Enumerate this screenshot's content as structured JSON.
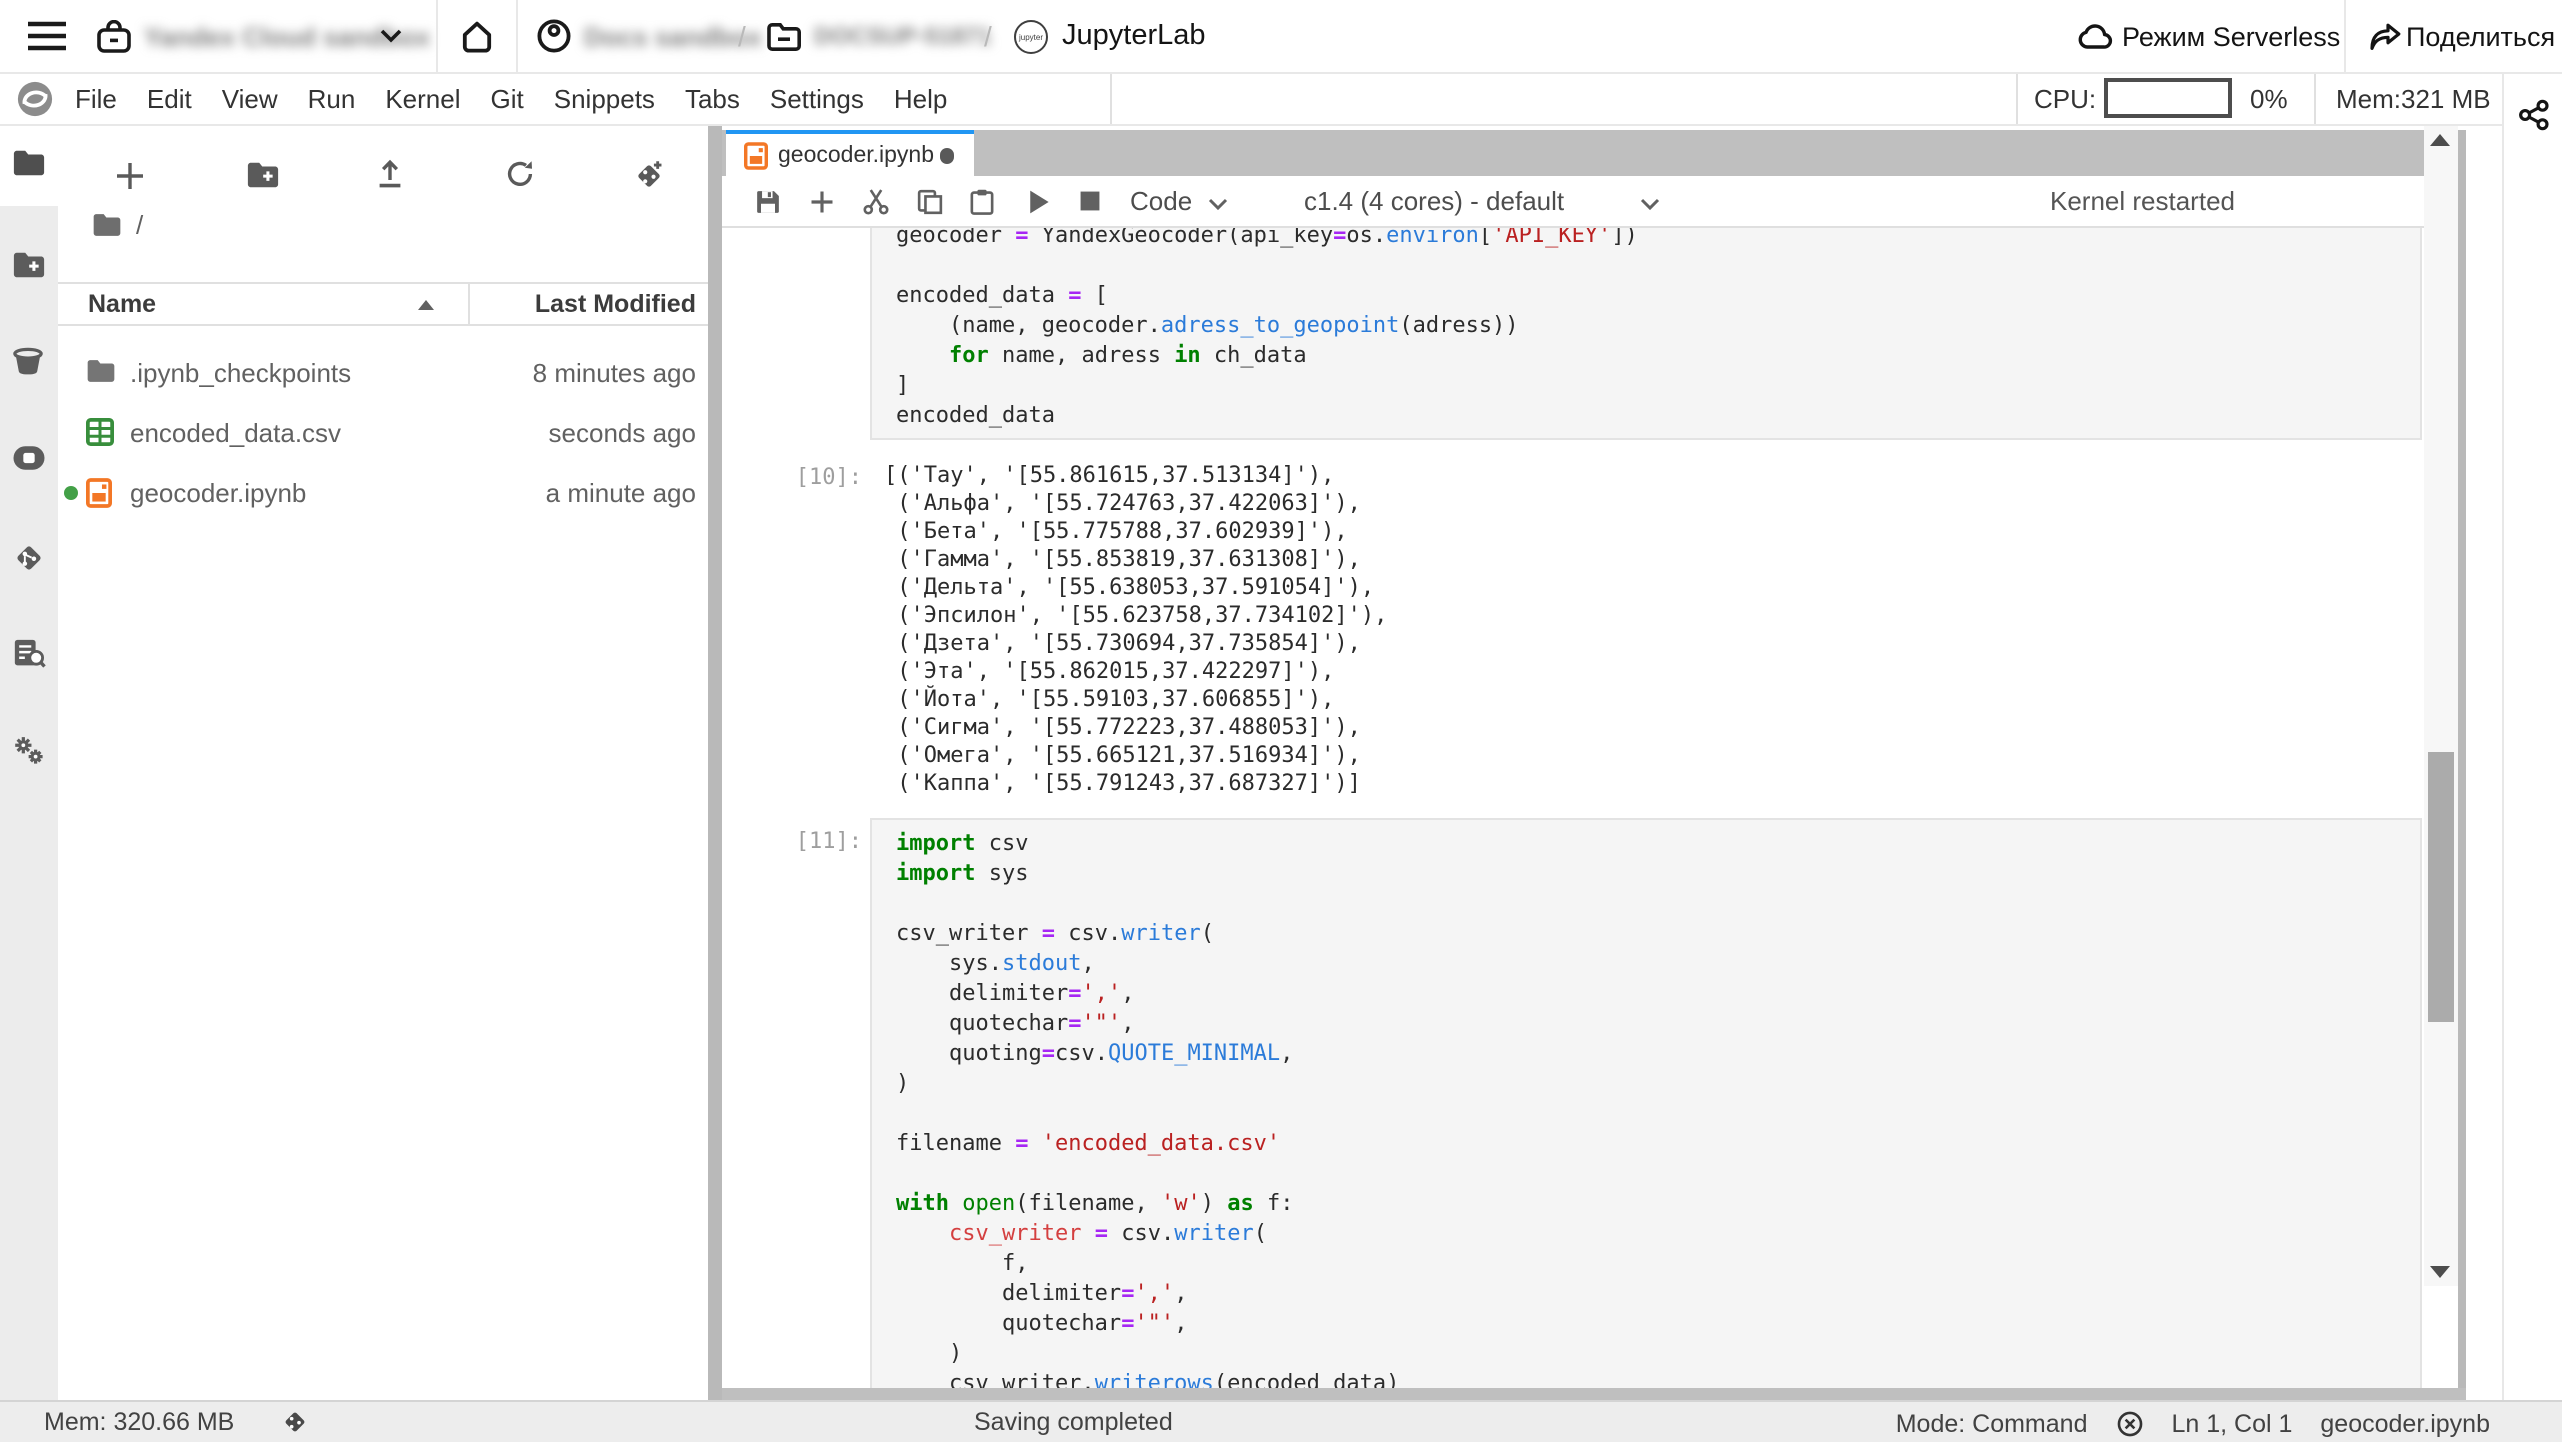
{
  "topbar": {
    "brand": "JupyterLab",
    "path_separator": "/",
    "serverless_label": "Режим Serverless",
    "share_label": "Поделиться",
    "redacted_labels": [
      "Yandex Cloud sandbox",
      "Docs sandbox",
      "DOCSUP-51871"
    ]
  },
  "menubar": {
    "items": [
      "File",
      "Edit",
      "View",
      "Run",
      "Kernel",
      "Git",
      "Snippets",
      "Tabs",
      "Settings",
      "Help"
    ],
    "cpu_label": "CPU:",
    "cpu_percent": "0%",
    "mem_label": "Mem:321 MB"
  },
  "filebrowser": {
    "breadcrumb_root": "/",
    "name_column": "Name",
    "modified_column": "Last Modified",
    "files": [
      {
        "name": ".ipynb_checkpoints",
        "modified": "8 minutes ago",
        "icon": "folder",
        "dirty": false
      },
      {
        "name": "encoded_data.csv",
        "modified": "seconds ago",
        "icon": "csv",
        "dirty": false
      },
      {
        "name": "geocoder.ipynb",
        "modified": "a minute ago",
        "icon": "notebook",
        "dirty": true
      }
    ]
  },
  "dock": {
    "tab_title": "geocoder.ipynb",
    "toolbar": {
      "cell_type": "Code",
      "kernel_selector": "c1.4 (4 cores) - default",
      "status_message": "Kernel restarted"
    }
  },
  "notebook": {
    "cells": [
      {
        "kind": "code",
        "prompt": "",
        "lines": [
          [
            [
              "v",
              "geocoder "
            ],
            [
              "o",
              "="
            ],
            [
              "v",
              " YandexGeocoder(api_key"
            ],
            [
              "o",
              "="
            ],
            [
              "v",
              "os."
            ],
            [
              "p",
              "environ"
            ],
            [
              "v",
              "["
            ],
            [
              "s",
              "'API_KEY'"
            ],
            [
              "v",
              "])"
            ]
          ],
          [],
          [
            [
              "v",
              "encoded_data "
            ],
            [
              "o",
              "="
            ],
            [
              "v",
              " ["
            ]
          ],
          [
            [
              "v",
              "    (name, geocoder."
            ],
            [
              "p",
              "adress_to_geopoint"
            ],
            [
              "v",
              "(adress))"
            ]
          ],
          [
            [
              "v",
              "    "
            ],
            [
              "k",
              "for"
            ],
            [
              "v",
              " name, adress "
            ],
            [
              "k",
              "in"
            ],
            [
              "v",
              " ch_data"
            ]
          ],
          [
            [
              "v",
              "]"
            ]
          ],
          [
            [
              "v",
              "encoded_data"
            ]
          ]
        ]
      },
      {
        "kind": "output",
        "prompt": "[10]:",
        "lines": [
          "[('Тау', '[55.861615,37.513134]'),",
          " ('Альфа', '[55.724763,37.422063]'),",
          " ('Бета', '[55.775788,37.602939]'),",
          " ('Гамма', '[55.853819,37.631308]'),",
          " ('Дельта', '[55.638053,37.591054]'),",
          " ('Эпсилон', '[55.623758,37.734102]'),",
          " ('Дзета', '[55.730694,37.735854]'),",
          " ('Эта', '[55.862015,37.422297]'),",
          " ('Йота', '[55.59103,37.606855]'),",
          " ('Сигма', '[55.772223,37.488053]'),",
          " ('Омега', '[55.665121,37.516934]'),",
          " ('Каппа', '[55.791243,37.687327]')]"
        ]
      },
      {
        "kind": "code",
        "prompt": "[11]:",
        "lines": [
          [
            [
              "k",
              "import"
            ],
            [
              "v",
              " csv"
            ]
          ],
          [
            [
              "k",
              "import"
            ],
            [
              "v",
              " sys"
            ]
          ],
          [],
          [
            [
              "v",
              "csv_writer "
            ],
            [
              "o",
              "="
            ],
            [
              "v",
              " csv."
            ],
            [
              "p",
              "writer"
            ],
            [
              "v",
              "("
            ]
          ],
          [
            [
              "v",
              "    sys."
            ],
            [
              "p",
              "stdout"
            ],
            [
              "v",
              ","
            ]
          ],
          [
            [
              "v",
              "    delimiter"
            ],
            [
              "o",
              "="
            ],
            [
              "s",
              "','"
            ],
            [
              "v",
              ","
            ]
          ],
          [
            [
              "v",
              "    quotechar"
            ],
            [
              "o",
              "="
            ],
            [
              "s",
              "'\"'"
            ],
            [
              "v",
              ","
            ]
          ],
          [
            [
              "v",
              "    quoting"
            ],
            [
              "o",
              "="
            ],
            [
              "v",
              "csv."
            ],
            [
              "p",
              "QUOTE_MINIMAL"
            ],
            [
              "v",
              ","
            ]
          ],
          [
            [
              "v",
              ")"
            ]
          ],
          [],
          [
            [
              "v",
              "filename "
            ],
            [
              "o",
              "="
            ],
            [
              "v",
              " "
            ],
            [
              "s",
              "'encoded_data.csv'"
            ]
          ],
          [],
          [
            [
              "k",
              "with"
            ],
            [
              "v",
              " "
            ],
            [
              "b",
              "open"
            ],
            [
              "v",
              "(filename, "
            ],
            [
              "s",
              "'w'"
            ],
            [
              "v",
              ") "
            ],
            [
              "k",
              "as"
            ],
            [
              "v",
              " f:"
            ]
          ],
          [
            [
              "v",
              "    "
            ],
            [
              "r",
              "csv_writer"
            ],
            [
              "v",
              " "
            ],
            [
              "o",
              "="
            ],
            [
              "v",
              " csv."
            ],
            [
              "p",
              "writer"
            ],
            [
              "v",
              "("
            ]
          ],
          [
            [
              "v",
              "        f,"
            ]
          ],
          [
            [
              "v",
              "        delimiter"
            ],
            [
              "o",
              "="
            ],
            [
              "s",
              "','"
            ],
            [
              "v",
              ","
            ]
          ],
          [
            [
              "v",
              "        quotechar"
            ],
            [
              "o",
              "="
            ],
            [
              "s",
              "'\"'"
            ],
            [
              "v",
              ","
            ]
          ],
          [
            [
              "v",
              "    )"
            ]
          ],
          [
            [
              "v",
              "    csv_writer."
            ],
            [
              "p",
              "writerows"
            ],
            [
              "v",
              "(encoded_data)"
            ]
          ]
        ]
      }
    ]
  },
  "statusbar": {
    "mem": "Mem: 320.66 MB",
    "message": "Saving completed",
    "mode": "Mode: Command",
    "cursor": "Ln 1, Col 1",
    "file": "geocoder.ipynb"
  }
}
